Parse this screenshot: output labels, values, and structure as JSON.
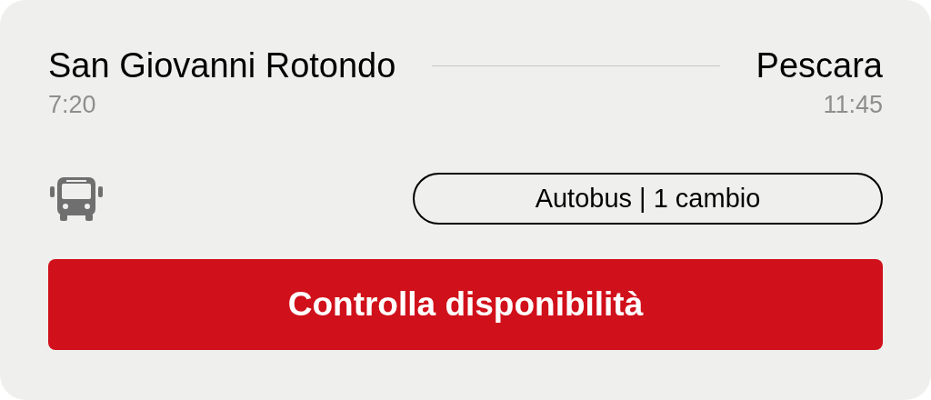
{
  "route": {
    "origin": "San Giovanni Rotondo",
    "destination": "Pescara",
    "departure": "7:20",
    "arrival": "11:45"
  },
  "transport": {
    "label": "Autobus | 1 cambio"
  },
  "action": {
    "label": "Controlla disponibilità"
  }
}
